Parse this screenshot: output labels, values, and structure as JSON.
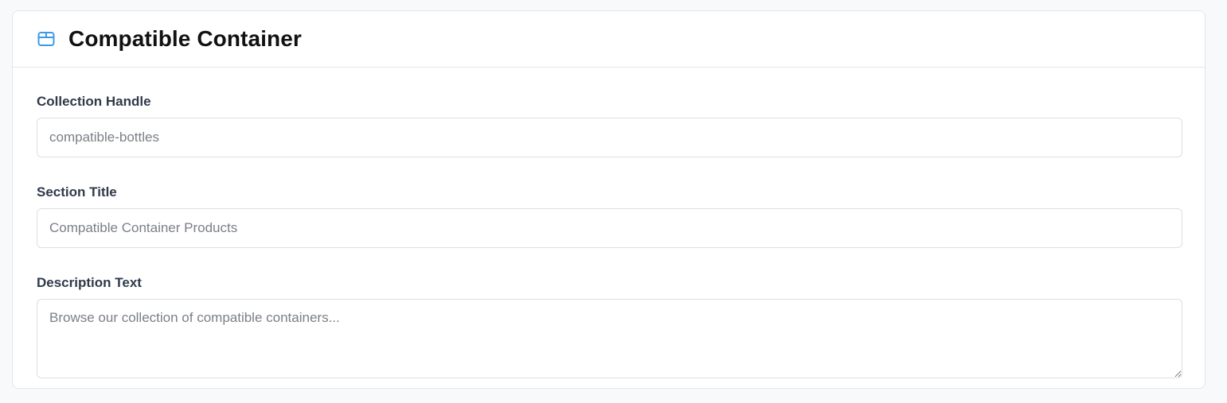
{
  "panel": {
    "title": "Compatible Container",
    "icon": "package-icon",
    "accent_color": "#3b9ae8"
  },
  "fields": {
    "collection_handle": {
      "label": "Collection Handle",
      "value": "",
      "placeholder": "compatible-bottles"
    },
    "section_title": {
      "label": "Section Title",
      "value": "",
      "placeholder": "Compatible Container Products"
    },
    "description_text": {
      "label": "Description Text",
      "value": "",
      "placeholder": "Browse our collection of compatible containers..."
    }
  }
}
